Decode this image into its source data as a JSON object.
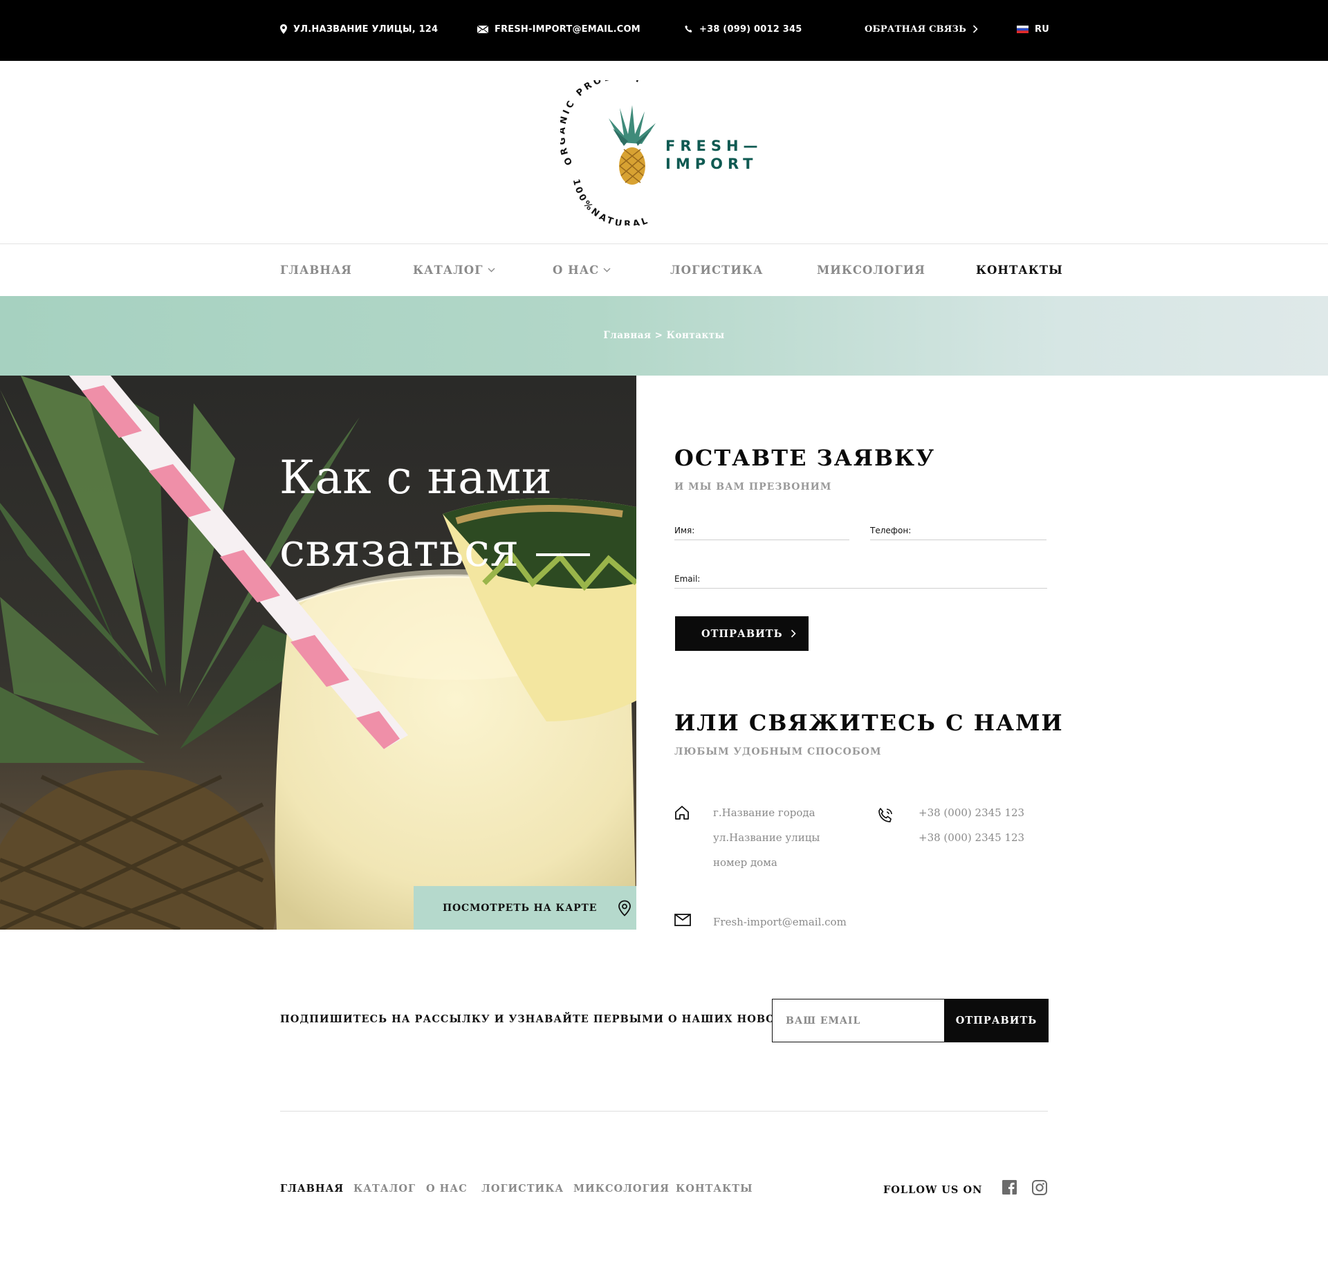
{
  "topbar": {
    "address": "УЛ.НАЗВАНИЕ УЛИЦЫ, 124",
    "email": "FRESH-IMPORT@EMAIL.COM",
    "phone": "+38 (099) 0012 345",
    "feedback": "ОБРАТНАЯ СВЯЗЬ",
    "language": "RU",
    "icons": [
      "map-pin-icon",
      "envelope-icon",
      "phone-icon",
      "chevron-right-icon",
      "russian-flag-icon"
    ]
  },
  "logo": {
    "arc_text_top": "ORGANIC PRODUCT",
    "arc_text_bottom": "100%NATURAL",
    "brand_line1": "FRESH—",
    "brand_line2": "IMPORT",
    "brand_color": "#0f5a52"
  },
  "nav": {
    "items": [
      {
        "label": "ГЛАВНАЯ",
        "has_dropdown": false,
        "active": false
      },
      {
        "label": "КАТАЛОГ",
        "has_dropdown": true,
        "active": false
      },
      {
        "label": "О НАС",
        "has_dropdown": true,
        "active": false
      },
      {
        "label": "ЛОГИСТИКА",
        "has_dropdown": false,
        "active": false
      },
      {
        "label": "МИКСОЛОГИЯ",
        "has_dropdown": false,
        "active": false
      },
      {
        "label": "КОНТАКТЫ",
        "has_dropdown": false,
        "active": true
      }
    ]
  },
  "breadcrumb": {
    "text": "Главная > Контакты"
  },
  "hero": {
    "title_line1": "Как с нами",
    "title_line2": "связаться",
    "map_button": "ПОСМОТРЕТЬ НА КАРТЕ"
  },
  "form": {
    "title": "ОСТАВТЕ ЗАЯВКУ",
    "subtitle": "И МЫ ВАМ ПРЕЗВОНИМ",
    "name_label": "Имя:",
    "phone_label": "Телефон:",
    "email_label": "Email:",
    "name_value": "",
    "phone_value": "",
    "email_value": "",
    "submit": "ОТПРАВИТЬ"
  },
  "contacts": {
    "title": "ИЛИ СВЯЖИТЕСЬ С НАМИ",
    "subtitle": "ЛЮБЫМ УДОБНЫМ СПОСОБОМ",
    "address_lines": [
      "г.Название города",
      "ул.Название улицы",
      "номер дома"
    ],
    "phones": [
      "+38 (000) 2345 123",
      "+38 (000) 2345 123"
    ],
    "email": "Fresh-import@email.com"
  },
  "newsletter": {
    "label": "ПОДПИШИТЕСЬ НА РАССЫЛКУ И УЗНАВАЙТЕ ПЕРВЫМИ О НАШИХ НОВОСТЯХ",
    "placeholder": "ВАШ EMAIL",
    "button": "ОТПРАВИТЬ"
  },
  "footer": {
    "nav": [
      "ГЛАВНАЯ",
      "КАТАЛОГ",
      "О НАС",
      "ЛОГИСТИКА",
      "МИКСОЛОГИЯ",
      "КОНТАКТЫ"
    ],
    "active_index": 0,
    "follow": "FOLLOW US ON",
    "socials": [
      "facebook-icon",
      "instagram-icon"
    ]
  },
  "colors": {
    "accent_mint": "#b5d9cc",
    "black": "#0b0b0b",
    "muted_text": "#8a8a8a"
  }
}
